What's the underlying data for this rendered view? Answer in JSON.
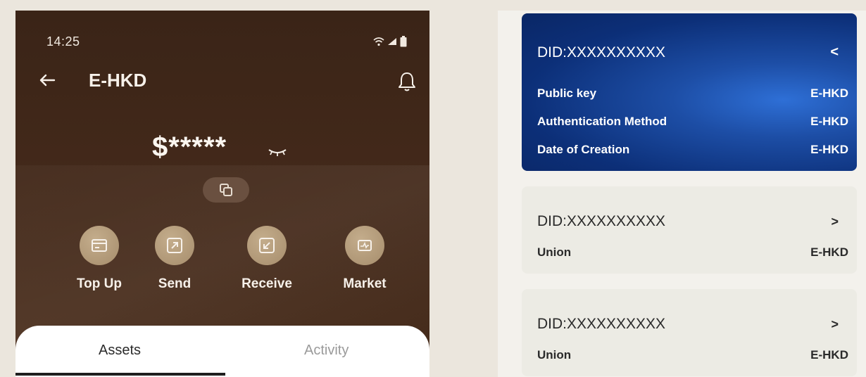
{
  "wallet_screen": {
    "status_time": "14:25",
    "title": "E-HKD",
    "balance": "$*****",
    "actions": [
      {
        "label": "Top Up",
        "icon": "card-icon"
      },
      {
        "label": "Send",
        "icon": "arrow-up-right-icon"
      },
      {
        "label": "Receive",
        "icon": "arrow-down-left-icon"
      },
      {
        "label": "Market",
        "icon": "chart-icon"
      }
    ],
    "tabs": [
      {
        "label": "Assets",
        "active": true
      },
      {
        "label": "Activity",
        "active": false
      }
    ]
  },
  "did_list": {
    "expanded_card": {
      "did": "DID:XXXXXXXXXX",
      "rows": [
        {
          "label": "Public key",
          "value": "E-HKD"
        },
        {
          "label": "Authentication Method",
          "value": "E-HKD"
        },
        {
          "label": "Date of Creation",
          "value": "E-HKD"
        }
      ]
    },
    "collapsed_cards": [
      {
        "did": "DID:XXXXXXXXXX",
        "label": "Union",
        "value": "E-HKD"
      },
      {
        "did": "DID:XXXXXXXXXX",
        "label": "Union",
        "value": "E-HKD"
      }
    ]
  },
  "colors": {
    "phone_background": "#3a2417",
    "action_circle": "#b39b79",
    "card_blue": "#0c2f78",
    "card_gray": "#ecebe4"
  }
}
